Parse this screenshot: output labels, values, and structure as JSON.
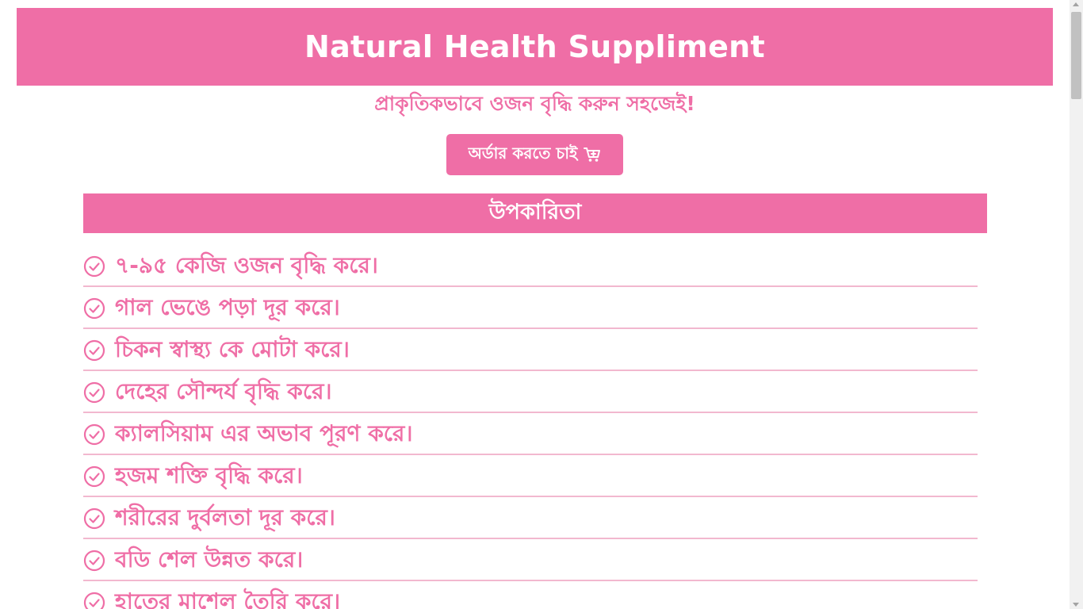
{
  "banner": {
    "title": "Natural Health Suppliment"
  },
  "subtitle": "প্রাকৃতিকভাবে ওজন বৃদ্ধি করুন সহজেই!",
  "order_button": {
    "label": "অর্ডার করতে চাই",
    "icon": "cart-plus-icon"
  },
  "benefits": {
    "heading": "উপকারিতা",
    "item_icon": "check-circle-icon",
    "items": [
      "৭-৯৫ কেজি ওজন বৃদ্ধি করে।",
      "গাল ভেঙে পড়া দূর করে।",
      "চিকন স্বাস্থ্য কে মোটা করে।",
      "দেহের সৌন্দর্য বৃদ্ধি করে।",
      "ক্যালসিয়াম এর অভাব পূরণ করে।",
      "হজম শক্তি বৃদ্ধি করে।",
      "শরীরের দুর্বলতা দূর করে।",
      "বডি শেল উন্নত করে।",
      "হাতের মাশেল তৈরি করে।"
    ]
  },
  "colors": {
    "accent": "#ef6ea6",
    "divider": "#f2b8cf",
    "background": "#ffffff"
  }
}
